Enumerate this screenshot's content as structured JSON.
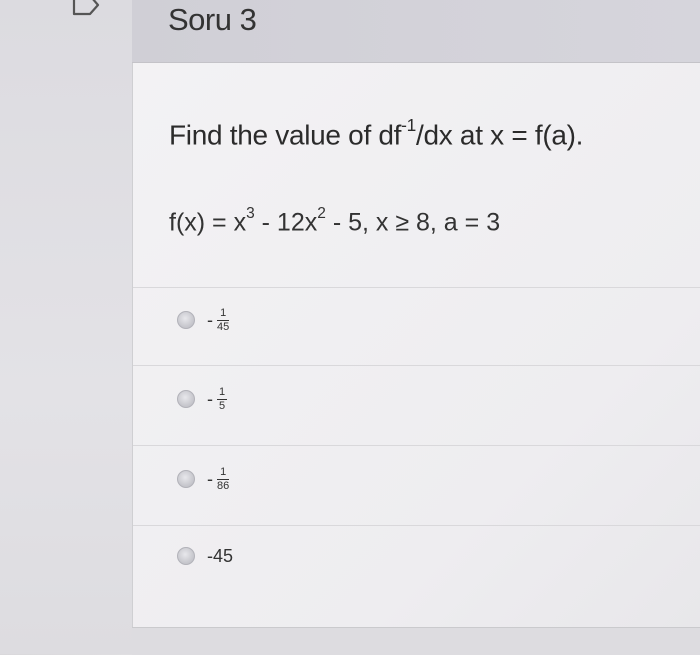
{
  "question": {
    "title": "Soru 3",
    "prompt": "Find the value of df-1/dx at x = f(a).",
    "prompt_parts": {
      "before": "Find the value of df",
      "sup": "-1",
      "after": "/dx at x = f(a)."
    },
    "formula_parts": {
      "p1": "f(x) = x",
      "sup1": "3",
      "p2": " - 12x",
      "sup2": "2",
      "p3": " - 5, x ≥ 8, a = 3"
    }
  },
  "options": [
    {
      "sign": "-",
      "numerator": "1",
      "denominator": "45"
    },
    {
      "sign": "-",
      "numerator": "1",
      "denominator": "5"
    },
    {
      "sign": "-",
      "numerator": "1",
      "denominator": "86"
    },
    {
      "text": "-45"
    }
  ],
  "icons": {
    "flag": "flag-icon",
    "radio": "radio-circle-icon"
  },
  "colors": {
    "header": "#d4d3da",
    "body": "#f0eff2",
    "text": "#2b2b2b"
  }
}
